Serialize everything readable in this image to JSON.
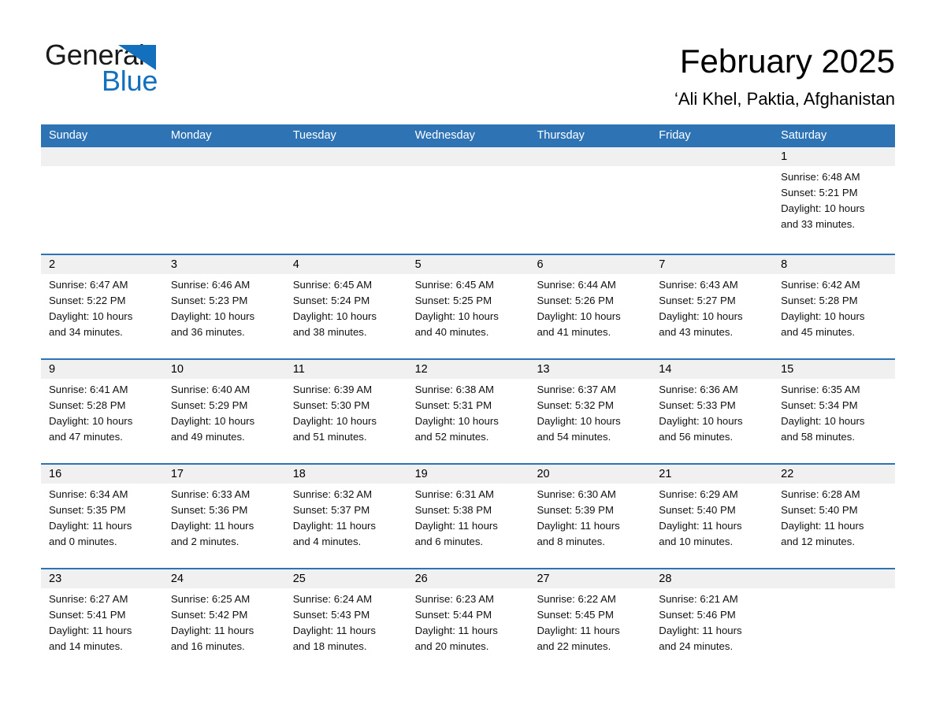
{
  "brand": {
    "logo_text_primary": "General",
    "logo_text_secondary": "Blue",
    "primary_color": "#1270bd",
    "header_color": "#2e74b5",
    "day_band_color": "#f0f0f0"
  },
  "header": {
    "month_title": "February 2025",
    "location": "‘Ali Khel, Paktia, Afghanistan"
  },
  "weekdays": [
    {
      "label": "Sunday"
    },
    {
      "label": "Monday"
    },
    {
      "label": "Tuesday"
    },
    {
      "label": "Wednesday"
    },
    {
      "label": "Thursday"
    },
    {
      "label": "Friday"
    },
    {
      "label": "Saturday"
    }
  ],
  "weeks": [
    {
      "days": [
        {
          "number": "",
          "sunrise": "",
          "sunset": "",
          "daylight_line1": "",
          "daylight_line2": "",
          "empty": true
        },
        {
          "number": "",
          "sunrise": "",
          "sunset": "",
          "daylight_line1": "",
          "daylight_line2": "",
          "empty": true
        },
        {
          "number": "",
          "sunrise": "",
          "sunset": "",
          "daylight_line1": "",
          "daylight_line2": "",
          "empty": true
        },
        {
          "number": "",
          "sunrise": "",
          "sunset": "",
          "daylight_line1": "",
          "daylight_line2": "",
          "empty": true
        },
        {
          "number": "",
          "sunrise": "",
          "sunset": "",
          "daylight_line1": "",
          "daylight_line2": "",
          "empty": true
        },
        {
          "number": "",
          "sunrise": "",
          "sunset": "",
          "daylight_line1": "",
          "daylight_line2": "",
          "empty": true
        },
        {
          "number": "1",
          "sunrise": "Sunrise: 6:48 AM",
          "sunset": "Sunset: 5:21 PM",
          "daylight_line1": "Daylight: 10 hours",
          "daylight_line2": "and 33 minutes.",
          "empty": false
        }
      ]
    },
    {
      "days": [
        {
          "number": "2",
          "sunrise": "Sunrise: 6:47 AM",
          "sunset": "Sunset: 5:22 PM",
          "daylight_line1": "Daylight: 10 hours",
          "daylight_line2": "and 34 minutes.",
          "empty": false
        },
        {
          "number": "3",
          "sunrise": "Sunrise: 6:46 AM",
          "sunset": "Sunset: 5:23 PM",
          "daylight_line1": "Daylight: 10 hours",
          "daylight_line2": "and 36 minutes.",
          "empty": false
        },
        {
          "number": "4",
          "sunrise": "Sunrise: 6:45 AM",
          "sunset": "Sunset: 5:24 PM",
          "daylight_line1": "Daylight: 10 hours",
          "daylight_line2": "and 38 minutes.",
          "empty": false
        },
        {
          "number": "5",
          "sunrise": "Sunrise: 6:45 AM",
          "sunset": "Sunset: 5:25 PM",
          "daylight_line1": "Daylight: 10 hours",
          "daylight_line2": "and 40 minutes.",
          "empty": false
        },
        {
          "number": "6",
          "sunrise": "Sunrise: 6:44 AM",
          "sunset": "Sunset: 5:26 PM",
          "daylight_line1": "Daylight: 10 hours",
          "daylight_line2": "and 41 minutes.",
          "empty": false
        },
        {
          "number": "7",
          "sunrise": "Sunrise: 6:43 AM",
          "sunset": "Sunset: 5:27 PM",
          "daylight_line1": "Daylight: 10 hours",
          "daylight_line2": "and 43 minutes.",
          "empty": false
        },
        {
          "number": "8",
          "sunrise": "Sunrise: 6:42 AM",
          "sunset": "Sunset: 5:28 PM",
          "daylight_line1": "Daylight: 10 hours",
          "daylight_line2": "and 45 minutes.",
          "empty": false
        }
      ]
    },
    {
      "days": [
        {
          "number": "9",
          "sunrise": "Sunrise: 6:41 AM",
          "sunset": "Sunset: 5:28 PM",
          "daylight_line1": "Daylight: 10 hours",
          "daylight_line2": "and 47 minutes.",
          "empty": false
        },
        {
          "number": "10",
          "sunrise": "Sunrise: 6:40 AM",
          "sunset": "Sunset: 5:29 PM",
          "daylight_line1": "Daylight: 10 hours",
          "daylight_line2": "and 49 minutes.",
          "empty": false
        },
        {
          "number": "11",
          "sunrise": "Sunrise: 6:39 AM",
          "sunset": "Sunset: 5:30 PM",
          "daylight_line1": "Daylight: 10 hours",
          "daylight_line2": "and 51 minutes.",
          "empty": false
        },
        {
          "number": "12",
          "sunrise": "Sunrise: 6:38 AM",
          "sunset": "Sunset: 5:31 PM",
          "daylight_line1": "Daylight: 10 hours",
          "daylight_line2": "and 52 minutes.",
          "empty": false
        },
        {
          "number": "13",
          "sunrise": "Sunrise: 6:37 AM",
          "sunset": "Sunset: 5:32 PM",
          "daylight_line1": "Daylight: 10 hours",
          "daylight_line2": "and 54 minutes.",
          "empty": false
        },
        {
          "number": "14",
          "sunrise": "Sunrise: 6:36 AM",
          "sunset": "Sunset: 5:33 PM",
          "daylight_line1": "Daylight: 10 hours",
          "daylight_line2": "and 56 minutes.",
          "empty": false
        },
        {
          "number": "15",
          "sunrise": "Sunrise: 6:35 AM",
          "sunset": "Sunset: 5:34 PM",
          "daylight_line1": "Daylight: 10 hours",
          "daylight_line2": "and 58 minutes.",
          "empty": false
        }
      ]
    },
    {
      "days": [
        {
          "number": "16",
          "sunrise": "Sunrise: 6:34 AM",
          "sunset": "Sunset: 5:35 PM",
          "daylight_line1": "Daylight: 11 hours",
          "daylight_line2": "and 0 minutes.",
          "empty": false
        },
        {
          "number": "17",
          "sunrise": "Sunrise: 6:33 AM",
          "sunset": "Sunset: 5:36 PM",
          "daylight_line1": "Daylight: 11 hours",
          "daylight_line2": "and 2 minutes.",
          "empty": false
        },
        {
          "number": "18",
          "sunrise": "Sunrise: 6:32 AM",
          "sunset": "Sunset: 5:37 PM",
          "daylight_line1": "Daylight: 11 hours",
          "daylight_line2": "and 4 minutes.",
          "empty": false
        },
        {
          "number": "19",
          "sunrise": "Sunrise: 6:31 AM",
          "sunset": "Sunset: 5:38 PM",
          "daylight_line1": "Daylight: 11 hours",
          "daylight_line2": "and 6 minutes.",
          "empty": false
        },
        {
          "number": "20",
          "sunrise": "Sunrise: 6:30 AM",
          "sunset": "Sunset: 5:39 PM",
          "daylight_line1": "Daylight: 11 hours",
          "daylight_line2": "and 8 minutes.",
          "empty": false
        },
        {
          "number": "21",
          "sunrise": "Sunrise: 6:29 AM",
          "sunset": "Sunset: 5:40 PM",
          "daylight_line1": "Daylight: 11 hours",
          "daylight_line2": "and 10 minutes.",
          "empty": false
        },
        {
          "number": "22",
          "sunrise": "Sunrise: 6:28 AM",
          "sunset": "Sunset: 5:40 PM",
          "daylight_line1": "Daylight: 11 hours",
          "daylight_line2": "and 12 minutes.",
          "empty": false
        }
      ]
    },
    {
      "days": [
        {
          "number": "23",
          "sunrise": "Sunrise: 6:27 AM",
          "sunset": "Sunset: 5:41 PM",
          "daylight_line1": "Daylight: 11 hours",
          "daylight_line2": "and 14 minutes.",
          "empty": false
        },
        {
          "number": "24",
          "sunrise": "Sunrise: 6:25 AM",
          "sunset": "Sunset: 5:42 PM",
          "daylight_line1": "Daylight: 11 hours",
          "daylight_line2": "and 16 minutes.",
          "empty": false
        },
        {
          "number": "25",
          "sunrise": "Sunrise: 6:24 AM",
          "sunset": "Sunset: 5:43 PM",
          "daylight_line1": "Daylight: 11 hours",
          "daylight_line2": "and 18 minutes.",
          "empty": false
        },
        {
          "number": "26",
          "sunrise": "Sunrise: 6:23 AM",
          "sunset": "Sunset: 5:44 PM",
          "daylight_line1": "Daylight: 11 hours",
          "daylight_line2": "and 20 minutes.",
          "empty": false
        },
        {
          "number": "27",
          "sunrise": "Sunrise: 6:22 AM",
          "sunset": "Sunset: 5:45 PM",
          "daylight_line1": "Daylight: 11 hours",
          "daylight_line2": "and 22 minutes.",
          "empty": false
        },
        {
          "number": "28",
          "sunrise": "Sunrise: 6:21 AM",
          "sunset": "Sunset: 5:46 PM",
          "daylight_line1": "Daylight: 11 hours",
          "daylight_line2": "and 24 minutes.",
          "empty": false
        },
        {
          "number": "",
          "sunrise": "",
          "sunset": "",
          "daylight_line1": "",
          "daylight_line2": "",
          "empty": true
        }
      ]
    }
  ]
}
